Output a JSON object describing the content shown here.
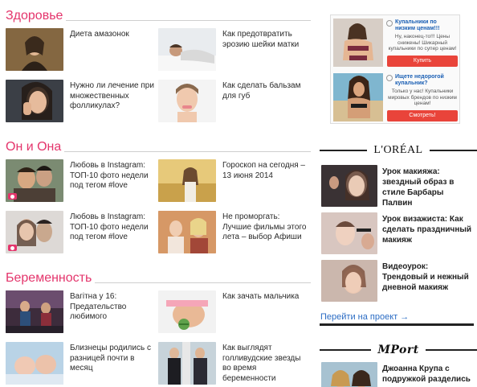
{
  "sections": [
    {
      "title": "Здоровье",
      "items": [
        {
          "label": "Диета амазонок"
        },
        {
          "label": "Как предотвратить эрозию шейки матки"
        },
        {
          "label": "Нужно ли лечение при множественных фолликулах?"
        },
        {
          "label": "Как сделать бальзам для губ"
        }
      ]
    },
    {
      "title": "Он и Она",
      "items": [
        {
          "label": "Любовь в Instagram: ТОП-10 фото недели под тегом #love"
        },
        {
          "label": "Гороскоп на сегодня – 13 июня 2014"
        },
        {
          "label": "Любовь в Instagram: ТОП-10 фото недели под тегом #love"
        },
        {
          "label": "Не проморгать: Лучшие фильмы этого лета – выбор Афиши"
        }
      ]
    },
    {
      "title": "Беременность",
      "items": [
        {
          "label": "Вагітна у 16: Предательство любимого"
        },
        {
          "label": "Как зачать мальчика"
        },
        {
          "label": "Близнецы родились с разницей почти в месяц"
        },
        {
          "label": "Как выглядят голливудские звезды во время беременности"
        }
      ]
    }
  ],
  "ads": [
    {
      "title": "Купальники по низким ценам!!!",
      "text": "Ну, наконец-то!!! Цены снижены! Шикарный купальники по супер ценам!",
      "button": "Купить"
    },
    {
      "title": "Ищете недорогой купальник?",
      "text": "Только у нас! Купальники мировых брендов по низким ценам!",
      "button": "Смотреть!"
    }
  ],
  "loreal": {
    "brand": "L'ORÉAL",
    "items": [
      {
        "label": "Урок макияжа: звездный образ в стиле Барбары Палвин"
      },
      {
        "label": "Урок визажиста: Как сделать праздничный макияж"
      },
      {
        "label": "Видеоурок: Трендовый и нежный дневной макияж"
      }
    ],
    "goto": "Перейти на проект →"
  },
  "mport": {
    "brand": "MPort",
    "items": [
      {
        "label": "Джоанна Крупа с подружкой разделись для"
      }
    ]
  }
}
